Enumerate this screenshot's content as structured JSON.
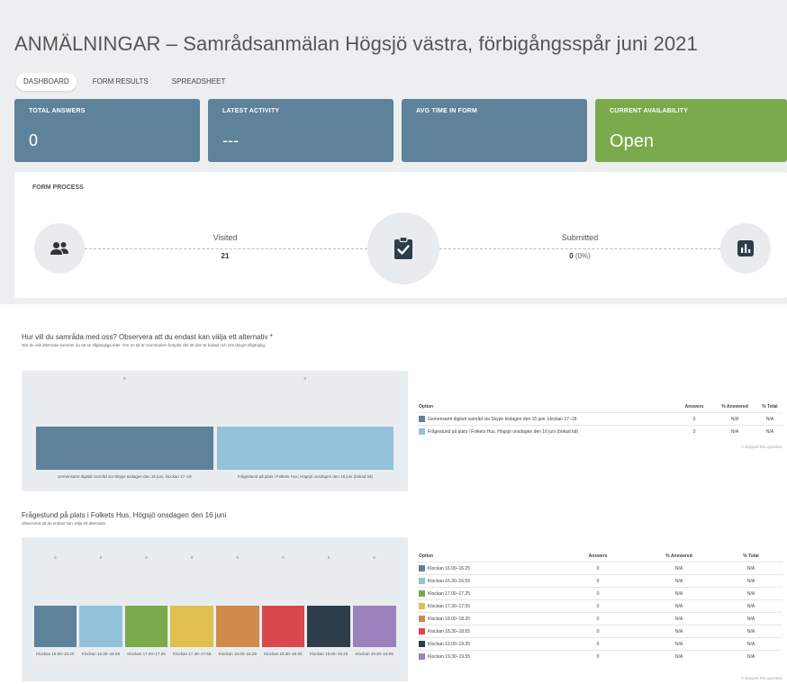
{
  "page": {
    "title": "ANMÄLNINGAR – Samrådsanmälan Högsjö västra, förbigångsspår juni 2021",
    "tabs": [
      "DASHBOARD",
      "FORM RESULTS",
      "SPREADSHEET"
    ]
  },
  "stats": {
    "total_answers": {
      "label": "TOTAL ANSWERS",
      "value": "0"
    },
    "latest_activity": {
      "label": "LATEST ACTIVITY",
      "value": "---"
    },
    "avg_time": {
      "label": "AVG TIME IN FORM",
      "value": ""
    },
    "availability": {
      "label": "CURRENT AVAILABILITY",
      "value": "Open"
    }
  },
  "colors": {
    "stat_blue": "#5e8299",
    "stat_green": "#7aaa4b"
  },
  "process": {
    "title": "FORM PROCESS",
    "visited_label": "Visited",
    "visited_value": "21",
    "submitted_label": "Submitted",
    "submitted_value": "0",
    "submitted_pct": "(0%)",
    "icons": [
      "users-icon",
      "clipboard-check-icon",
      "bar-chart-icon"
    ]
  },
  "q1": {
    "title": "Hur vill du samråda med oss? Observera att du endast kan välja ett alternativ *",
    "subtitle": "När du valt alternativ kommer du att se tillgängliga tider. Om en tid är överstruken betyder det att den är bokad och inte längre tillgänglig.",
    "headers": [
      "Option",
      "Answers",
      "% Answered",
      "% Total"
    ],
    "rows": [
      {
        "option": "Gemensamt digitalt samråd via Skype tisdagen den 15 juni, klockan 17–18",
        "answers": "0",
        "answered": "N/A",
        "total": "N/A",
        "color": "#5e8299"
      },
      {
        "option": "Frågestund på plats i Folkets Hus, Högsjö onsdagen den 16 juni (bokad tid)",
        "answers": "0",
        "answered": "N/A",
        "total": "N/A",
        "color": "#94c2da"
      }
    ],
    "skipped": "0 skipped this question"
  },
  "q2": {
    "title": "Frågestund på plats i Folkets Hus, Högsjö onsdagen den 16 juni",
    "subtitle": "Observera att du endast kan välja ett alternativ.",
    "headers": [
      "Option",
      "Answers",
      "% Answered",
      "% Total"
    ],
    "rows": [
      {
        "option": "Klockan 16.00–16.25",
        "answers": "0",
        "answered": "N/A",
        "total": "N/A",
        "color": "#5e8299"
      },
      {
        "option": "Klockan 16.30–16.55",
        "answers": "0",
        "answered": "N/A",
        "total": "N/A",
        "color": "#94c2da"
      },
      {
        "option": "Klockan 17.00–17.25",
        "answers": "0",
        "answered": "N/A",
        "total": "N/A",
        "color": "#7aaa4b"
      },
      {
        "option": "Klockan 17.30–17.55",
        "answers": "0",
        "answered": "N/A",
        "total": "N/A",
        "color": "#dfc04f"
      },
      {
        "option": "Klockan 18.00–18.25",
        "answers": "0",
        "answered": "N/A",
        "total": "N/A",
        "color": "#cf8a4c"
      },
      {
        "option": "Klockan 18.30–18.55",
        "answers": "0",
        "answered": "N/A",
        "total": "N/A",
        "color": "#d9484b"
      },
      {
        "option": "Klockan 19.00–19.25",
        "answers": "0",
        "answered": "N/A",
        "total": "N/A",
        "color": "#2e3d4a"
      },
      {
        "option": "Klockan 19.30–19.55",
        "answers": "0",
        "answered": "N/A",
        "total": "N/A",
        "color": "#9b82bd"
      }
    ],
    "skipped": "0 skipped this question"
  },
  "chart_data": [
    {
      "type": "bar",
      "categories": [
        "Gemensamt digitalt samråd via Skype tisdagen den 15 juni, klockan 17–18",
        "Frågestund på plats i Folkets Hus, Högsjö onsdagen den 16 juni (bokad tid)"
      ],
      "values": [
        0,
        0
      ],
      "colors": [
        "#5e8299",
        "#94c2da"
      ],
      "title": "Hur vill du samråda med oss? Observera att du endast kan välja ett alternativ *",
      "grid": false
    },
    {
      "type": "bar",
      "categories": [
        "Klockan 16.00–16.25",
        "Klockan 16.30–16.55",
        "Klockan 17.00–17.25",
        "Klockan 17.30–17.55",
        "Klockan 18.00–18.25",
        "Klockan 18.30–18.55",
        "Klockan 19.00–19.25",
        "Klockan 19.30–19.55"
      ],
      "values": [
        0,
        0,
        0,
        0,
        0,
        0,
        0,
        0
      ],
      "colors": [
        "#5e8299",
        "#94c2da",
        "#7aaa4b",
        "#dfc04f",
        "#cf8a4c",
        "#d9484b",
        "#2e3d4a",
        "#9b82bd"
      ],
      "title": "Frågestund på plats i Folkets Hus, Högsjö onsdagen den 16 juni",
      "grid": false
    }
  ]
}
